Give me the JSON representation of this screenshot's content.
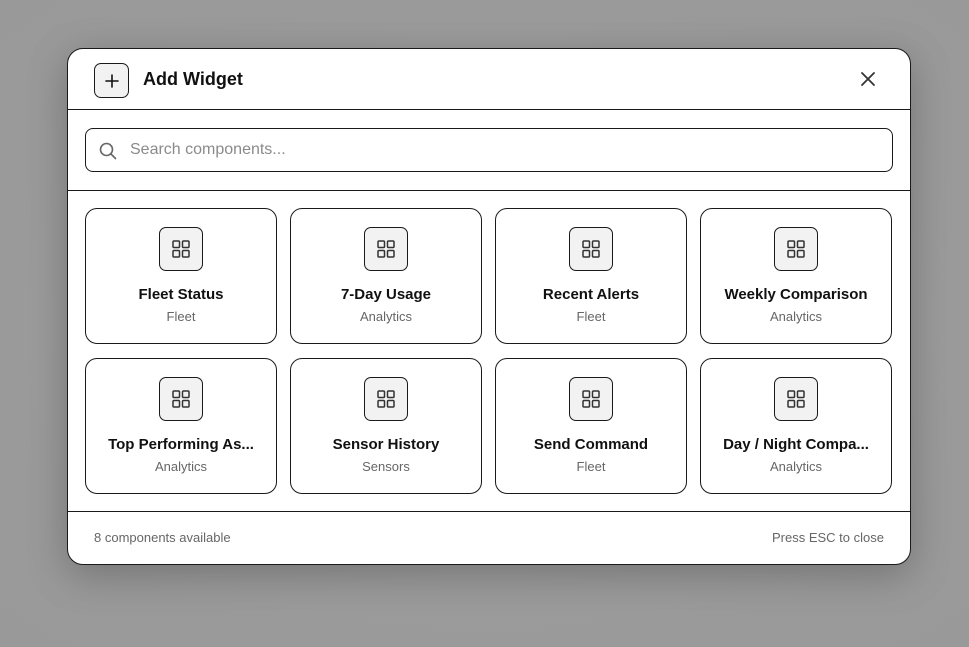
{
  "modal": {
    "title": "Add Widget",
    "header_icon": "plus-icon",
    "close_icon": "close-icon"
  },
  "search": {
    "placeholder": "Search components...",
    "value": ""
  },
  "components": [
    {
      "title": "Fleet Status",
      "category": "Fleet",
      "icon": "grid-icon"
    },
    {
      "title": "7-Day Usage",
      "category": "Analytics",
      "icon": "grid-icon"
    },
    {
      "title": "Recent Alerts",
      "category": "Fleet",
      "icon": "grid-icon"
    },
    {
      "title": "Weekly Comparison",
      "category": "Analytics",
      "icon": "grid-icon"
    },
    {
      "title": "Top Performing As...",
      "category": "Analytics",
      "icon": "grid-icon"
    },
    {
      "title": "Sensor History",
      "category": "Sensors",
      "icon": "grid-icon"
    },
    {
      "title": "Send Command",
      "category": "Fleet",
      "icon": "grid-icon"
    },
    {
      "title": "Day / Night Compa...",
      "category": "Analytics",
      "icon": "grid-icon"
    }
  ],
  "footer": {
    "count_text": "8 components available",
    "hint_text": "Press ESC to close"
  }
}
